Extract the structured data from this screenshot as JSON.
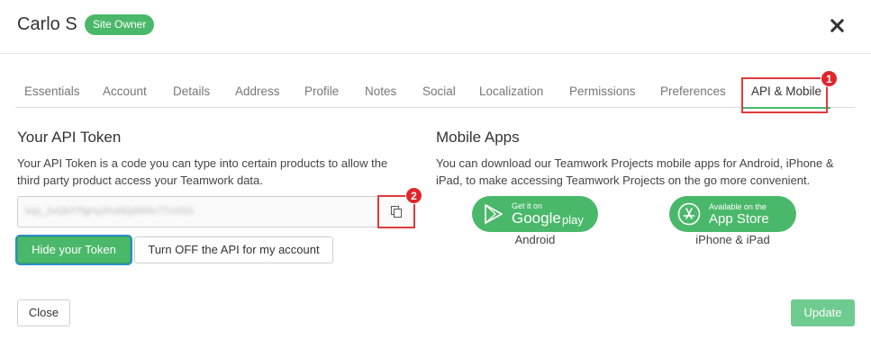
{
  "header": {
    "user_name": "Carlo S",
    "badge": "Site Owner"
  },
  "tabs": [
    {
      "label": "Essentials",
      "active": false
    },
    {
      "label": "Account",
      "active": false
    },
    {
      "label": "Details",
      "active": false
    },
    {
      "label": "Address",
      "active": false
    },
    {
      "label": "Profile",
      "active": false
    },
    {
      "label": "Notes",
      "active": false
    },
    {
      "label": "Social",
      "active": false
    },
    {
      "label": "Localization",
      "active": false
    },
    {
      "label": "Permissions",
      "active": false
    },
    {
      "label": "Preferences",
      "active": false
    },
    {
      "label": "API & Mobile",
      "active": true
    }
  ],
  "markers": [
    "1",
    "2"
  ],
  "api": {
    "title": "Your API Token",
    "description": "Your API Token is a code you can type into certain products to allow the third party product access your Teamwork data.",
    "token_value": "twp_3xQk5TfgHy2hvbEjd9Wc7TnX5G",
    "hide_button": "Hide your Token",
    "api_off_button": "Turn OFF the API for my account"
  },
  "mobile": {
    "title": "Mobile Apps",
    "description": "You can download our Teamwork Projects mobile apps for Android, iPhone & iPad, to make accessing Teamwork Projects on the go more convenient.",
    "google_small": "Get it on",
    "google_big": "Google",
    "google_suffix": "play",
    "google_caption": "Android",
    "apple_small": "Available on the",
    "apple_big": "App Store",
    "apple_caption": "iPhone & iPad"
  },
  "footer": {
    "close_button": "Close",
    "update_button": "Update"
  },
  "colors": {
    "accent_green": "#4ab86a",
    "marker_red": "#e0262b",
    "focus_blue": "#2b8fc9"
  }
}
